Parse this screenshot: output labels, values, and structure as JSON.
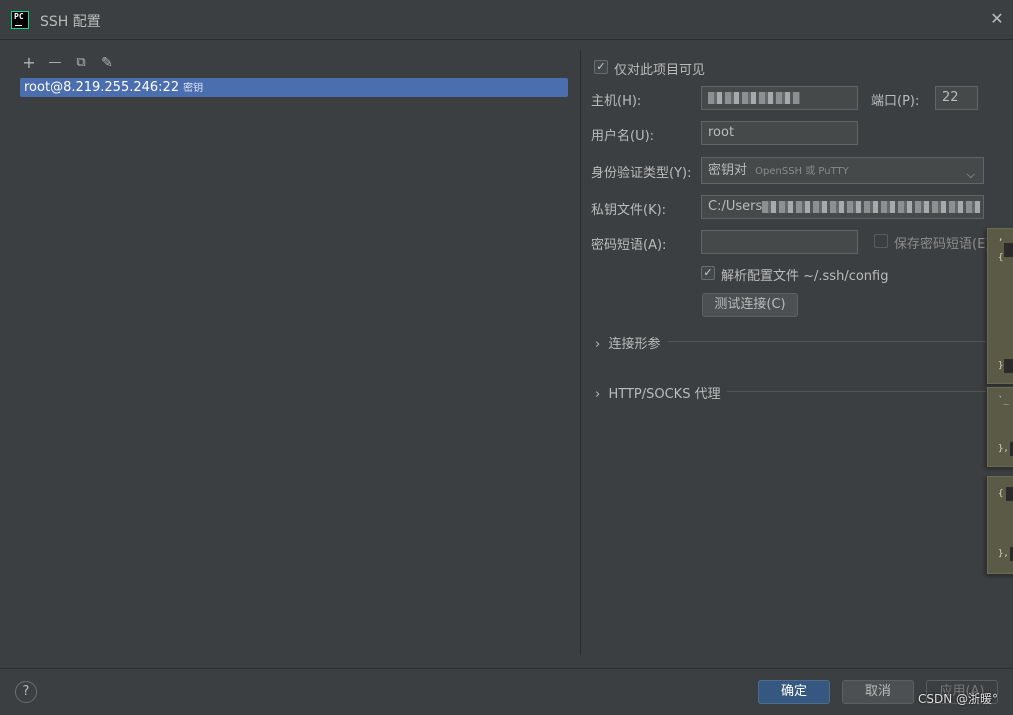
{
  "window": {
    "title": "SSH 配置",
    "app_icon_text": "PC",
    "close_glyph": "✕"
  },
  "toolbar": {
    "add_glyph": "+",
    "remove_glyph": "—",
    "copy_glyph": "⧉",
    "edit_glyph": "✎"
  },
  "list": {
    "items": [
      {
        "label": "root@8.219.255.246:22",
        "tag": "密钥"
      }
    ]
  },
  "form": {
    "visible_only_label": "仅对此项目可见",
    "host_label": "主机(H):",
    "host_value": "",
    "port_label": "端口(P):",
    "port_value": "22",
    "username_label": "用户名(U):",
    "username_value": "root",
    "auth_label": "身份验证类型(Y):",
    "auth_value": "密钥对",
    "auth_hint": "OpenSSH 或 PuTTY",
    "keyfile_label": "私钥文件(K):",
    "keyfile_value": "C:/Users",
    "passphrase_label": "密码短语(A):",
    "passphrase_value": "",
    "save_passphrase_label": "保存密码短语(E)",
    "parse_config_label": "解析配置文件 ~/.ssh/config",
    "test_button": "测试连接(C)"
  },
  "sections": {
    "connection_params": "连接形参",
    "proxy": "HTTP/SOCKS 代理"
  },
  "footer": {
    "help_glyph": "?",
    "ok_button": "确定",
    "cancel_button": "取消",
    "apply_button": "应用(A)",
    "watermark": "CSDN @浙暖°"
  },
  "popup_glyphs": {
    "card1_top": ",",
    "card1_brace_open": "{",
    "card1_brace_close": "}",
    "card2_top": "`_",
    "card2_close": "},",
    "card3_open": "{",
    "card3_close": "},"
  },
  "colors": {
    "background": "#3c3f41",
    "selection": "#4b6eaf",
    "primary_button": "#365880",
    "popup": "#5b5a47"
  }
}
